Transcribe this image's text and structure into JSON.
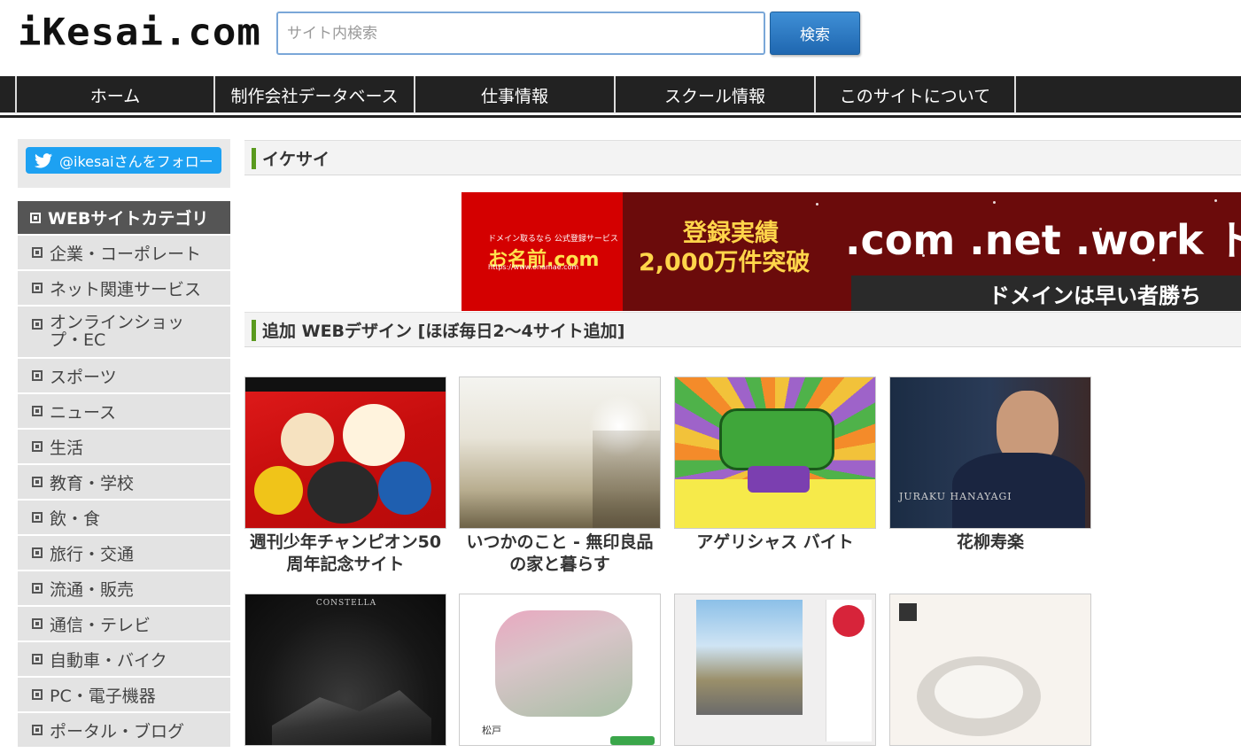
{
  "header": {
    "logo_text": "iKesai.com",
    "search_placeholder": "サイト内検索",
    "search_button": "検索"
  },
  "nav": {
    "items": [
      "ホーム",
      "制作会社データベース",
      "仕事情報",
      "スクール情報",
      "このサイトについて"
    ]
  },
  "sidebar": {
    "follow_label": "@ikesaiさんをフォロー",
    "category_title": "WEBサイトカテゴリ",
    "categories": [
      "企業・コーポレート",
      "ネット関連サービス",
      "オンラインショップ・EC",
      "スポーツ",
      "ニュース",
      "生活",
      "教育・学校",
      "飲・食",
      "旅行・交通",
      "流通・販売",
      "通信・テレビ",
      "自動車・バイク",
      "PC・電子機器",
      "ポータル・ブログ"
    ]
  },
  "main": {
    "section1_title": "イケサイ",
    "banner": {
      "small_text": "ドメイン取るなら 公式登録サービス",
      "brand": "お名前.com",
      "url": "https://www.onamae.com",
      "headline_1": "登録実績",
      "headline_2": "2,000万件突破",
      "domains": ".com .net .work ドメ",
      "bottom": "ドメインは早い者勝ち"
    },
    "section2_title": "追加 WEBデザイン [ほぼ毎日2〜4サイト追加]",
    "cards": [
      {
        "title": "週刊少年チャンピオン50周年記念サイト"
      },
      {
        "title": "いつかのこと - 無印良品の家と暮らす"
      },
      {
        "title": "アゲリシャス バイト"
      },
      {
        "title": "花柳寿楽"
      }
    ],
    "thumb_texts": {
      "constella": "CONSTELLA",
      "jurako": "JURAKU HANAYAGI",
      "matsudo": "松戸"
    }
  },
  "colors": {
    "nav_bg": "#222222",
    "accent_green": "#5a9a1e",
    "twitter_blue": "#1da1f2",
    "search_button": "#2a78c2"
  }
}
